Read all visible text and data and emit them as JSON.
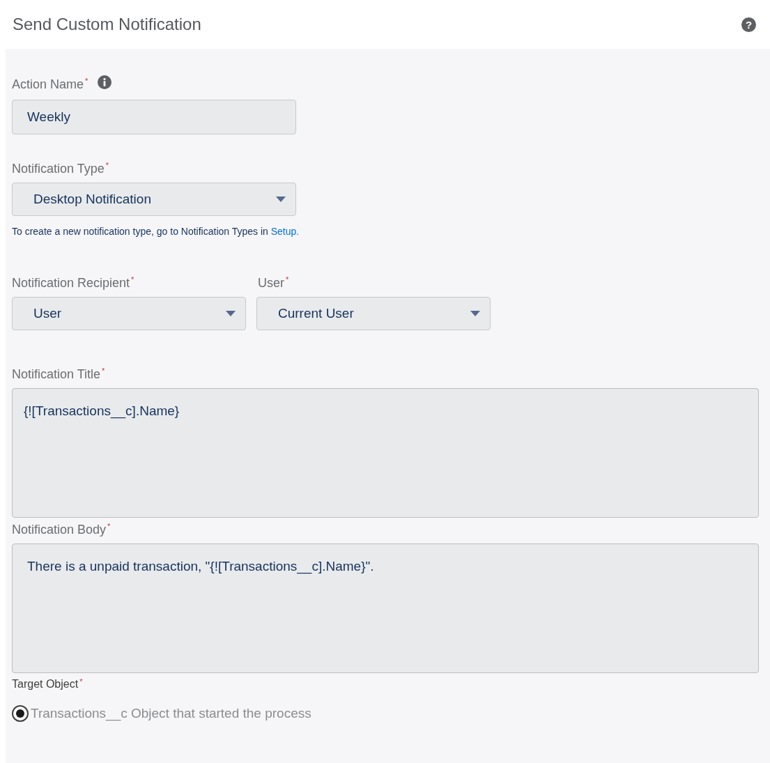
{
  "header": {
    "title": "Send Custom Notification",
    "help": "?"
  },
  "action_name": {
    "label": "Action Name",
    "required_mark": "*",
    "info": true,
    "value": "Weekly"
  },
  "notification_type": {
    "label": "Notification Type",
    "required_mark": "*",
    "value": "Desktop Notification",
    "hint": "To create a new notification type, go to Notification Types in ",
    "hint_link": "Setup."
  },
  "recipient_row": [
    {
      "label": "Notification Recipient",
      "required_mark": "*",
      "value": "User"
    },
    {
      "label": "User",
      "required_mark": "*",
      "value": "Current User"
    }
  ],
  "text_areas": [
    {
      "label": "Notification Title",
      "required_mark": "*",
      "value": "{![Transactions__c].Name}"
    },
    {
      "label": "Notification Body",
      "required_mark": "*",
      "value": "There is a unpaid transaction, \"{![Transactions__c].Name}\"."
    }
  ],
  "target_object": {
    "label": "Target Object",
    "required_mark": "*",
    "options": [
      {
        "label": "Transactions__c Object that started the process",
        "selected": true
      }
    ]
  }
}
